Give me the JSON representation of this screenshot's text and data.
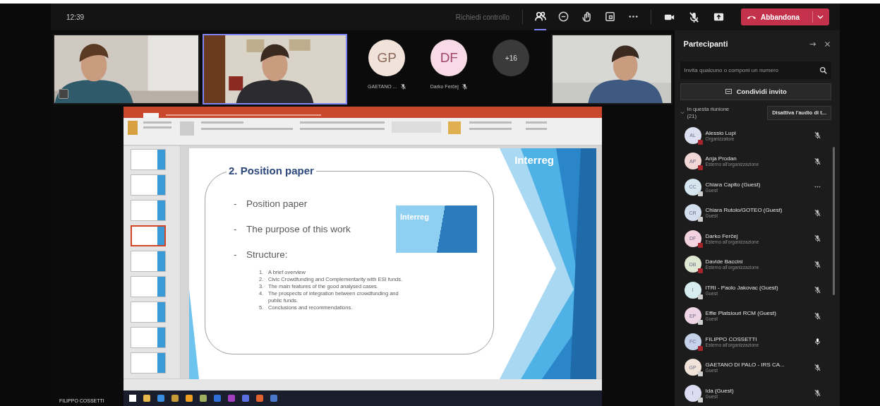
{
  "top_bar": {
    "time": "12:39",
    "request_control": "Richiedi controllo",
    "tools": [
      {
        "kind": "people",
        "selected": true
      },
      {
        "kind": "chat",
        "selected": false
      },
      {
        "kind": "reactions",
        "selected": false
      },
      {
        "kind": "rooms",
        "selected": false
      },
      {
        "kind": "more",
        "selected": false
      }
    ],
    "media": [
      {
        "kind": "camera"
      },
      {
        "kind": "mic-off"
      },
      {
        "kind": "share"
      }
    ],
    "leave_button": "Abbandona"
  },
  "video_row": [
    {
      "kind": "video",
      "selected": false,
      "pinned": true
    },
    {
      "kind": "video",
      "selected": true,
      "pinned": false
    },
    {
      "kind": "avatar",
      "initials": "GP",
      "name": "GAETANO ...",
      "color": "#f1e3da"
    },
    {
      "kind": "avatar",
      "initials": "DF",
      "name": "Darko Ferčej",
      "color": "#f7dae5"
    },
    {
      "kind": "overflow",
      "label": "+16"
    },
    {
      "kind": "video",
      "selected": false,
      "pinned": false
    }
  ],
  "shared_screen": {
    "presenter": "FILIPPO COSSETTI",
    "thumbnails": [
      {
        "selected": false
      },
      {
        "selected": false
      },
      {
        "selected": false
      },
      {
        "selected": true
      },
      {
        "selected": false
      },
      {
        "selected": false
      },
      {
        "selected": false
      },
      {
        "selected": false
      },
      {
        "selected": false
      }
    ],
    "slide": {
      "title": "2. Position paper",
      "bullets": [
        {
          "marker": "-",
          "text": "Position paper"
        },
        {
          "marker": "-",
          "text": "The purpose of this work"
        },
        {
          "marker": "-",
          "text": "Structure:"
        }
      ],
      "steps": [
        {
          "number": "1.",
          "text": "A brief overview"
        },
        {
          "number": "2.",
          "text": "Civic Crowdfunding and Complementarity with ESI funds."
        },
        {
          "number": "3.",
          "text": "The main features of the good analysed cases."
        },
        {
          "number": "4.",
          "text": "The prospects of integration between crowdfunding and public funds."
        },
        {
          "number": "5.",
          "text": "Conclusions and recommendations."
        }
      ],
      "logo": "Interreg",
      "inset_logo": "Interreg"
    },
    "taskbar": [
      {
        "color": "#e8b84a"
      },
      {
        "color": "#3b8de0"
      },
      {
        "color": "#c79a3a"
      },
      {
        "color": "#f0a020"
      },
      {
        "color": "#9fb060"
      },
      {
        "color": "#2f6fd6"
      },
      {
        "color": "#a040c0"
      },
      {
        "color": "#5a70e0"
      },
      {
        "color": "#e06030"
      },
      {
        "color": "#4a78c8"
      }
    ]
  },
  "panel": {
    "title": "Partecipanti",
    "search_placeholder": "Invita qualcuno o componi un numero",
    "share_invite": "Condividi invito",
    "section": {
      "label": "In questa riunione (21)",
      "expanded": true
    },
    "mute_all": "Disattiva l'audio di t...",
    "participants": [
      {
        "initials": "AL",
        "name": "Alessio Lupi",
        "role": "Organizzatore",
        "color": "#dde0f0",
        "guest": false,
        "muted": true,
        "hovered": false
      },
      {
        "initials": "AP",
        "name": "Anja Prodan",
        "role": "Esterno all'organizzazione",
        "color": "#f3d6d6",
        "guest": false,
        "muted": true,
        "hovered": false
      },
      {
        "initials": "CC",
        "name": "Chiara Capito (Guest)",
        "role": "Guest",
        "color": "#d6e6ef",
        "guest": true,
        "hovered": true
      },
      {
        "initials": "CR",
        "name": "Chiara Rutolo/GOTEO (Guest)",
        "role": "Guest",
        "color": "#d3deef",
        "guest": true,
        "muted": true,
        "hovered": false
      },
      {
        "initials": "DF",
        "name": "Darko Ferčej",
        "role": "Esterno all'organizzazione",
        "color": "#f3d3e0",
        "guest": false,
        "muted": true,
        "hovered": false
      },
      {
        "initials": "DB",
        "name": "Davide Baccini",
        "role": "Esterno all'organizzazione",
        "color": "#dfe8d3",
        "guest": false,
        "muted": true,
        "hovered": false
      },
      {
        "initials": "I",
        "name": "ITRI - Paolo Jakovac (Guest)",
        "role": "Guest",
        "color": "#d6ecef",
        "guest": true,
        "muted": true,
        "hovered": false
      },
      {
        "initials": "EP",
        "name": "Effie Platsiouri RCM (Guest)",
        "role": "Guest",
        "color": "#efd6e6",
        "guest": true,
        "muted": true,
        "hovered": false
      },
      {
        "initials": "FC",
        "name": "FILIPPO COSSETTI",
        "role": "Esterno all'organizzazione",
        "color": "#c6d2ea",
        "guest": false,
        "muted": false,
        "hovered": false
      },
      {
        "initials": "GP",
        "name": "GAETANO DI PALO - IRS CA...",
        "role": "Guest",
        "color": "#f1e3da",
        "guest": true,
        "muted": true,
        "hovered": false
      },
      {
        "initials": "I",
        "name": "Ida (Guest)",
        "role": "Guest",
        "color": "#dcdcf3",
        "guest": true,
        "muted": true,
        "hovered": false
      }
    ]
  }
}
